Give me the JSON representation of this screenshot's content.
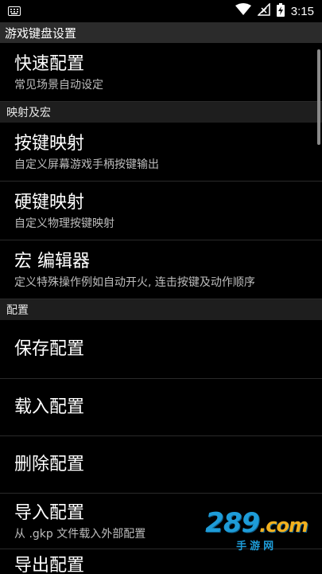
{
  "status_bar": {
    "time": "3:15",
    "icons": [
      "keyboard-icon",
      "wifi-icon",
      "no-signal-icon",
      "battery-charging-icon"
    ]
  },
  "app_bar": {
    "title": "游戏键盘设置"
  },
  "quick": {
    "title": "快速配置",
    "summary": "常见场景自动设定"
  },
  "categories": {
    "mapping": "映射及宏",
    "config": "配置"
  },
  "mapping_items": [
    {
      "title": "按键映射",
      "summary": "自定义屏幕游戏手柄按键输出"
    },
    {
      "title": "硬键映射",
      "summary": "自定义物理按键映射"
    },
    {
      "title": "宏 编辑器",
      "summary": "定义特殊操作例如自动开火, 连击按键及动作顺序"
    }
  ],
  "config_items": [
    {
      "title": "保存配置"
    },
    {
      "title": "载入配置"
    },
    {
      "title": "删除配置"
    },
    {
      "title": "导入配置",
      "summary": "从 .gkp 文件载入外部配置"
    },
    {
      "title": "导出配置"
    }
  ],
  "watermark": {
    "main": "289",
    "dotcom": ".com",
    "sub": "手游网"
  }
}
